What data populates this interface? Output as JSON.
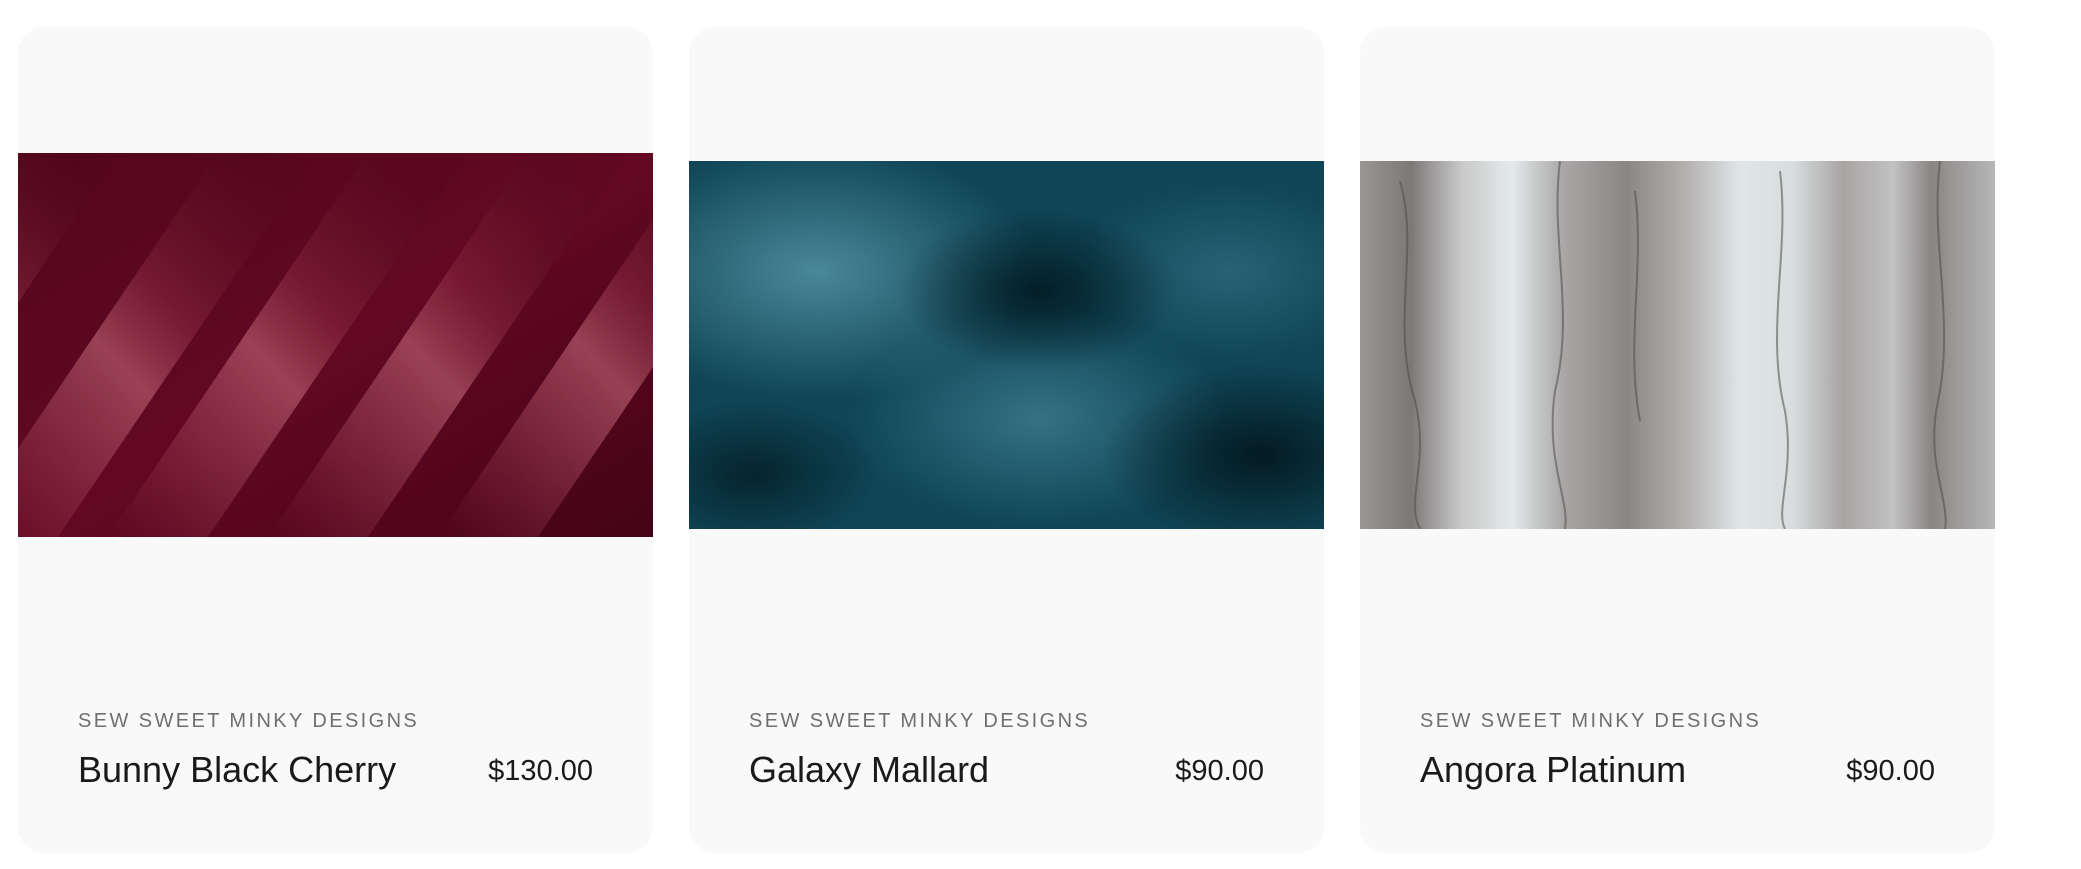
{
  "products": [
    {
      "vendor": "SEW SWEET MINKY DESIGNS",
      "name": "Bunny Black Cherry",
      "price": "$130.00",
      "image": "fabric-swatch-bunny-black-cherry",
      "base_color": "#6a0a24"
    },
    {
      "vendor": "SEW SWEET MINKY DESIGNS",
      "name": "Galaxy Mallard",
      "price": "$90.00",
      "image": "fabric-swatch-galaxy-mallard",
      "base_color": "#0f4a5c"
    },
    {
      "vendor": "SEW SWEET MINKY DESIGNS",
      "name": "Angora Platinum",
      "price": "$90.00",
      "image": "fabric-swatch-angora-platinum",
      "base_color": "#b8b8b8"
    }
  ]
}
